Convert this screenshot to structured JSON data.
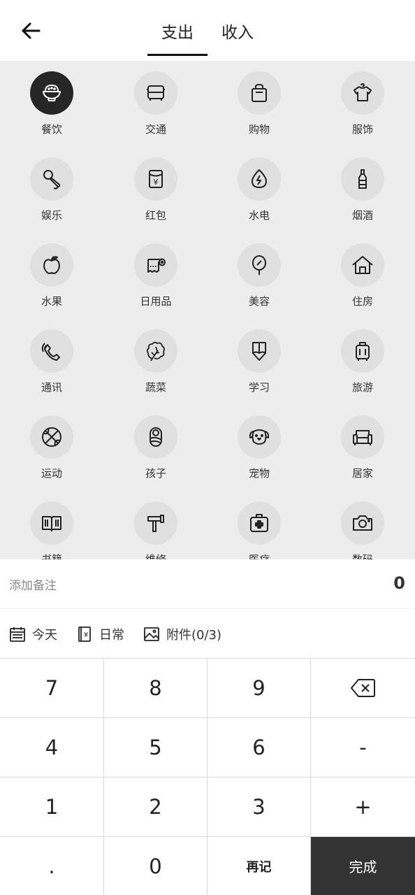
{
  "header": {
    "tabs": [
      {
        "label": "支出",
        "active": true
      },
      {
        "label": "收入",
        "active": false
      }
    ]
  },
  "categories": [
    {
      "label": "餐饮",
      "icon": "rice-bowl-icon",
      "active": true
    },
    {
      "label": "交通",
      "icon": "bus-icon"
    },
    {
      "label": "购物",
      "icon": "shopping-bag-icon"
    },
    {
      "label": "服饰",
      "icon": "shirt-icon"
    },
    {
      "label": "娱乐",
      "icon": "microphone-icon"
    },
    {
      "label": "红包",
      "icon": "red-envelope-icon"
    },
    {
      "label": "水电",
      "icon": "water-electric-icon"
    },
    {
      "label": "烟酒",
      "icon": "bottle-icon"
    },
    {
      "label": "水果",
      "icon": "apple-icon"
    },
    {
      "label": "日用品",
      "icon": "toilet-paper-icon"
    },
    {
      "label": "美容",
      "icon": "leaf-mirror-icon"
    },
    {
      "label": "住房",
      "icon": "house-icon"
    },
    {
      "label": "通讯",
      "icon": "phone-icon"
    },
    {
      "label": "蔬菜",
      "icon": "vegetable-icon"
    },
    {
      "label": "学习",
      "icon": "pencil-icon"
    },
    {
      "label": "旅游",
      "icon": "luggage-icon"
    },
    {
      "label": "运动",
      "icon": "basketball-icon"
    },
    {
      "label": "孩子",
      "icon": "baby-icon"
    },
    {
      "label": "宠物",
      "icon": "dog-icon"
    },
    {
      "label": "居家",
      "icon": "sofa-icon"
    },
    {
      "label": "书籍",
      "icon": "book-icon"
    },
    {
      "label": "维修",
      "icon": "hammer-icon"
    },
    {
      "label": "医疗",
      "icon": "medical-kit-icon"
    },
    {
      "label": "数码",
      "icon": "camera-icon"
    }
  ],
  "note": {
    "placeholder": "添加备注",
    "amount": "0"
  },
  "options": {
    "date_label": "今天",
    "book_label": "日常",
    "attachment_label": "附件(0/3)"
  },
  "keypad": {
    "keys": [
      "7",
      "8",
      "9",
      "⌫",
      "4",
      "5",
      "6",
      "-",
      "1",
      "2",
      "3",
      "+",
      ".",
      "0",
      "再记",
      "完成"
    ]
  },
  "colors": {
    "active_circle": "#262626",
    "circle": "#e0e0e0",
    "grid_bg": "#ededed",
    "done_key_bg": "#333333"
  }
}
